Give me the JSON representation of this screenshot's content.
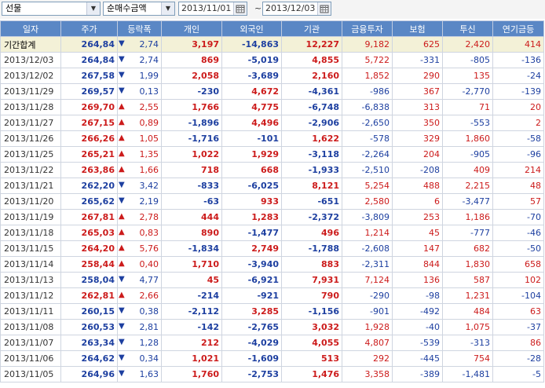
{
  "toolbar": {
    "market_select": "선물",
    "type_select": "순매수금액",
    "date_from": "2013/11/01",
    "date_to": "2013/12/03",
    "separator": "~"
  },
  "colors": {
    "up": "#cc1b1b",
    "down": "#1d3fa0",
    "header": "#5a87c5",
    "summary_row": "#f3f1d7"
  },
  "table": {
    "headers": [
      "일자",
      "주가",
      "등락폭",
      "개인",
      "외국인",
      "기관",
      "금융투자",
      "보험",
      "투신",
      "연기금등"
    ],
    "rows": [
      {
        "date": "기간합계",
        "price": "264,84",
        "dir": "down",
        "change": "2,74",
        "individual": "3,197",
        "foreign": "-14,863",
        "institution": "12,227",
        "fin_inv": "9,182",
        "insurance": "625",
        "trust": "2,420",
        "pension": "414"
      },
      {
        "date": "2013/12/03",
        "price": "264,84",
        "dir": "down",
        "change": "2,74",
        "individual": "869",
        "foreign": "-5,019",
        "institution": "4,855",
        "fin_inv": "5,722",
        "insurance": "-331",
        "trust": "-805",
        "pension": "-136"
      },
      {
        "date": "2013/12/02",
        "price": "267,58",
        "dir": "down",
        "change": "1,99",
        "individual": "2,058",
        "foreign": "-3,689",
        "institution": "2,160",
        "fin_inv": "1,852",
        "insurance": "290",
        "trust": "135",
        "pension": "-24"
      },
      {
        "date": "2013/11/29",
        "price": "269,57",
        "dir": "down",
        "change": "0,13",
        "individual": "-230",
        "foreign": "4,672",
        "institution": "-4,361",
        "fin_inv": "-986",
        "insurance": "367",
        "trust": "-2,770",
        "pension": "-139"
      },
      {
        "date": "2013/11/28",
        "price": "269,70",
        "dir": "up",
        "change": "2,55",
        "individual": "1,766",
        "foreign": "4,775",
        "institution": "-6,748",
        "fin_inv": "-6,838",
        "insurance": "313",
        "trust": "71",
        "pension": "20"
      },
      {
        "date": "2013/11/27",
        "price": "267,15",
        "dir": "up",
        "change": "0,89",
        "individual": "-1,896",
        "foreign": "4,496",
        "institution": "-2,906",
        "fin_inv": "-2,650",
        "insurance": "350",
        "trust": "-553",
        "pension": "2"
      },
      {
        "date": "2013/11/26",
        "price": "266,26",
        "dir": "up",
        "change": "1,05",
        "individual": "-1,716",
        "foreign": "-101",
        "institution": "1,622",
        "fin_inv": "-578",
        "insurance": "329",
        "trust": "1,860",
        "pension": "-58"
      },
      {
        "date": "2013/11/25",
        "price": "265,21",
        "dir": "up",
        "change": "1,35",
        "individual": "1,022",
        "foreign": "1,929",
        "institution": "-3,118",
        "fin_inv": "-2,264",
        "insurance": "204",
        "trust": "-905",
        "pension": "-96"
      },
      {
        "date": "2013/11/22",
        "price": "263,86",
        "dir": "up",
        "change": "1,66",
        "individual": "718",
        "foreign": "668",
        "institution": "-1,933",
        "fin_inv": "-2,510",
        "insurance": "-208",
        "trust": "409",
        "pension": "214"
      },
      {
        "date": "2013/11/21",
        "price": "262,20",
        "dir": "down",
        "change": "3,42",
        "individual": "-833",
        "foreign": "-6,025",
        "institution": "8,121",
        "fin_inv": "5,254",
        "insurance": "488",
        "trust": "2,215",
        "pension": "48"
      },
      {
        "date": "2013/11/20",
        "price": "265,62",
        "dir": "down",
        "change": "2,19",
        "individual": "-63",
        "foreign": "933",
        "institution": "-651",
        "fin_inv": "2,580",
        "insurance": "6",
        "trust": "-3,477",
        "pension": "57"
      },
      {
        "date": "2013/11/19",
        "price": "267,81",
        "dir": "up",
        "change": "2,78",
        "individual": "444",
        "foreign": "1,283",
        "institution": "-2,372",
        "fin_inv": "-3,809",
        "insurance": "253",
        "trust": "1,186",
        "pension": "-70"
      },
      {
        "date": "2013/11/18",
        "price": "265,03",
        "dir": "up",
        "change": "0,83",
        "individual": "890",
        "foreign": "-1,477",
        "institution": "496",
        "fin_inv": "1,214",
        "insurance": "45",
        "trust": "-777",
        "pension": "-46"
      },
      {
        "date": "2013/11/15",
        "price": "264,20",
        "dir": "up",
        "change": "5,76",
        "individual": "-1,834",
        "foreign": "2,749",
        "institution": "-1,788",
        "fin_inv": "-2,608",
        "insurance": "147",
        "trust": "682",
        "pension": "-50"
      },
      {
        "date": "2013/11/14",
        "price": "258,44",
        "dir": "up",
        "change": "0,40",
        "individual": "1,710",
        "foreign": "-3,940",
        "institution": "883",
        "fin_inv": "-2,311",
        "insurance": "844",
        "trust": "1,830",
        "pension": "658"
      },
      {
        "date": "2013/11/13",
        "price": "258,04",
        "dir": "down",
        "change": "4,77",
        "individual": "45",
        "foreign": "-6,921",
        "institution": "7,931",
        "fin_inv": "7,124",
        "insurance": "136",
        "trust": "587",
        "pension": "102"
      },
      {
        "date": "2013/11/12",
        "price": "262,81",
        "dir": "up",
        "change": "2,66",
        "individual": "-214",
        "foreign": "-921",
        "institution": "790",
        "fin_inv": "-290",
        "insurance": "-98",
        "trust": "1,231",
        "pension": "-104"
      },
      {
        "date": "2013/11/11",
        "price": "260,15",
        "dir": "down",
        "change": "0,38",
        "individual": "-2,112",
        "foreign": "3,285",
        "institution": "-1,156",
        "fin_inv": "-901",
        "insurance": "-492",
        "trust": "484",
        "pension": "63"
      },
      {
        "date": "2013/11/08",
        "price": "260,53",
        "dir": "down",
        "change": "2,81",
        "individual": "-142",
        "foreign": "-2,765",
        "institution": "3,032",
        "fin_inv": "1,928",
        "insurance": "-40",
        "trust": "1,075",
        "pension": "-37"
      },
      {
        "date": "2013/11/07",
        "price": "263,34",
        "dir": "down",
        "change": "1,28",
        "individual": "212",
        "foreign": "-4,029",
        "institution": "4,055",
        "fin_inv": "4,807",
        "insurance": "-539",
        "trust": "-313",
        "pension": "86"
      },
      {
        "date": "2013/11/06",
        "price": "264,62",
        "dir": "down",
        "change": "0,34",
        "individual": "1,021",
        "foreign": "-1,609",
        "institution": "513",
        "fin_inv": "292",
        "insurance": "-445",
        "trust": "754",
        "pension": "-28"
      },
      {
        "date": "2013/11/05",
        "price": "264,96",
        "dir": "down",
        "change": "1,63",
        "individual": "1,760",
        "foreign": "-2,753",
        "institution": "1,476",
        "fin_inv": "3,358",
        "insurance": "-389",
        "trust": "-1,481",
        "pension": "-5"
      }
    ]
  }
}
